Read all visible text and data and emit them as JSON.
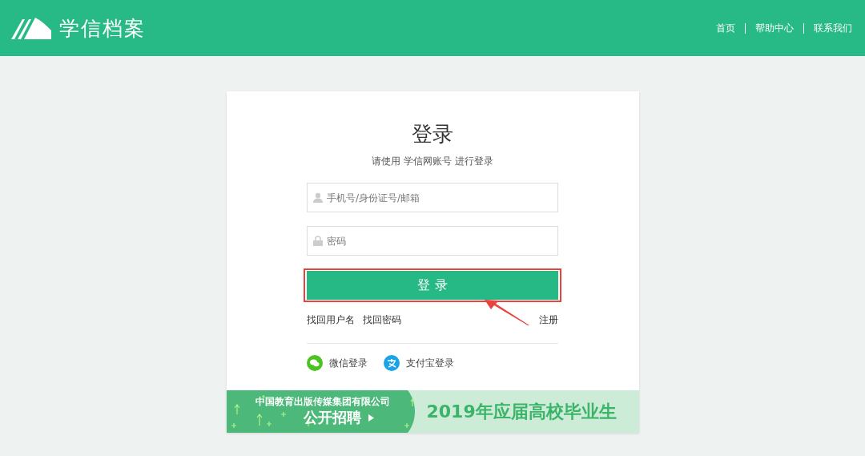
{
  "header": {
    "logo_text": "学信档案",
    "nav": [
      {
        "label": "首页"
      },
      {
        "label": "帮助中心"
      },
      {
        "label": "联系我们"
      }
    ]
  },
  "login": {
    "title": "登录",
    "subtitle": "请使用 学信网账号 进行登录",
    "username": {
      "placeholder": "手机号/身份证号/邮箱"
    },
    "password": {
      "placeholder": "密码"
    },
    "submit": "登 录",
    "links": [
      {
        "label": "找回用户名"
      },
      {
        "label": "找回密码"
      }
    ],
    "register": "注册",
    "social": [
      {
        "kind": "wechat",
        "label": "微信登录"
      },
      {
        "kind": "alipay",
        "label": "支付宝登录"
      }
    ]
  },
  "banner": {
    "company": "中国教育出版传媒集团有限公司",
    "cta": "公开招聘",
    "headline": "2019年应届高校毕业生"
  }
}
